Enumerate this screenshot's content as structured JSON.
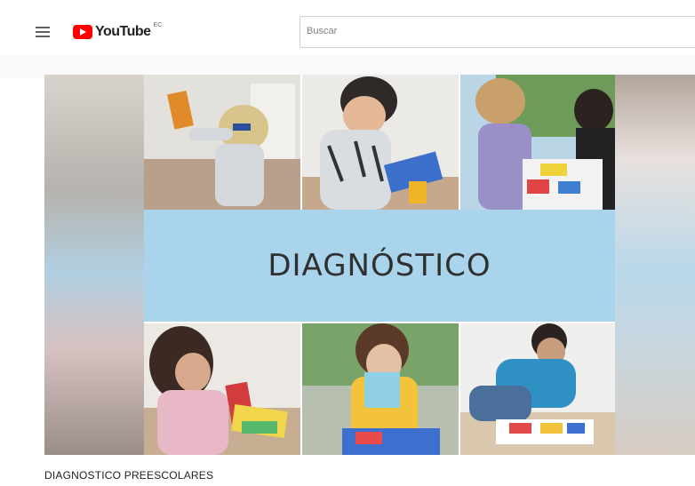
{
  "header": {
    "logo_text": "YouTube",
    "country_code": "EC",
    "search_placeholder": "Buscar"
  },
  "video": {
    "thumbnail_title": "DIAGNÓSTICO",
    "caption": "DIAGNOSTICO PREESCOLARES"
  },
  "icons": [
    "menu-icon",
    "youtube-play-icon"
  ],
  "colors": {
    "brand_red": "#ff0000",
    "banner_blue": "#a9d4ec",
    "title_text": "#303030"
  }
}
